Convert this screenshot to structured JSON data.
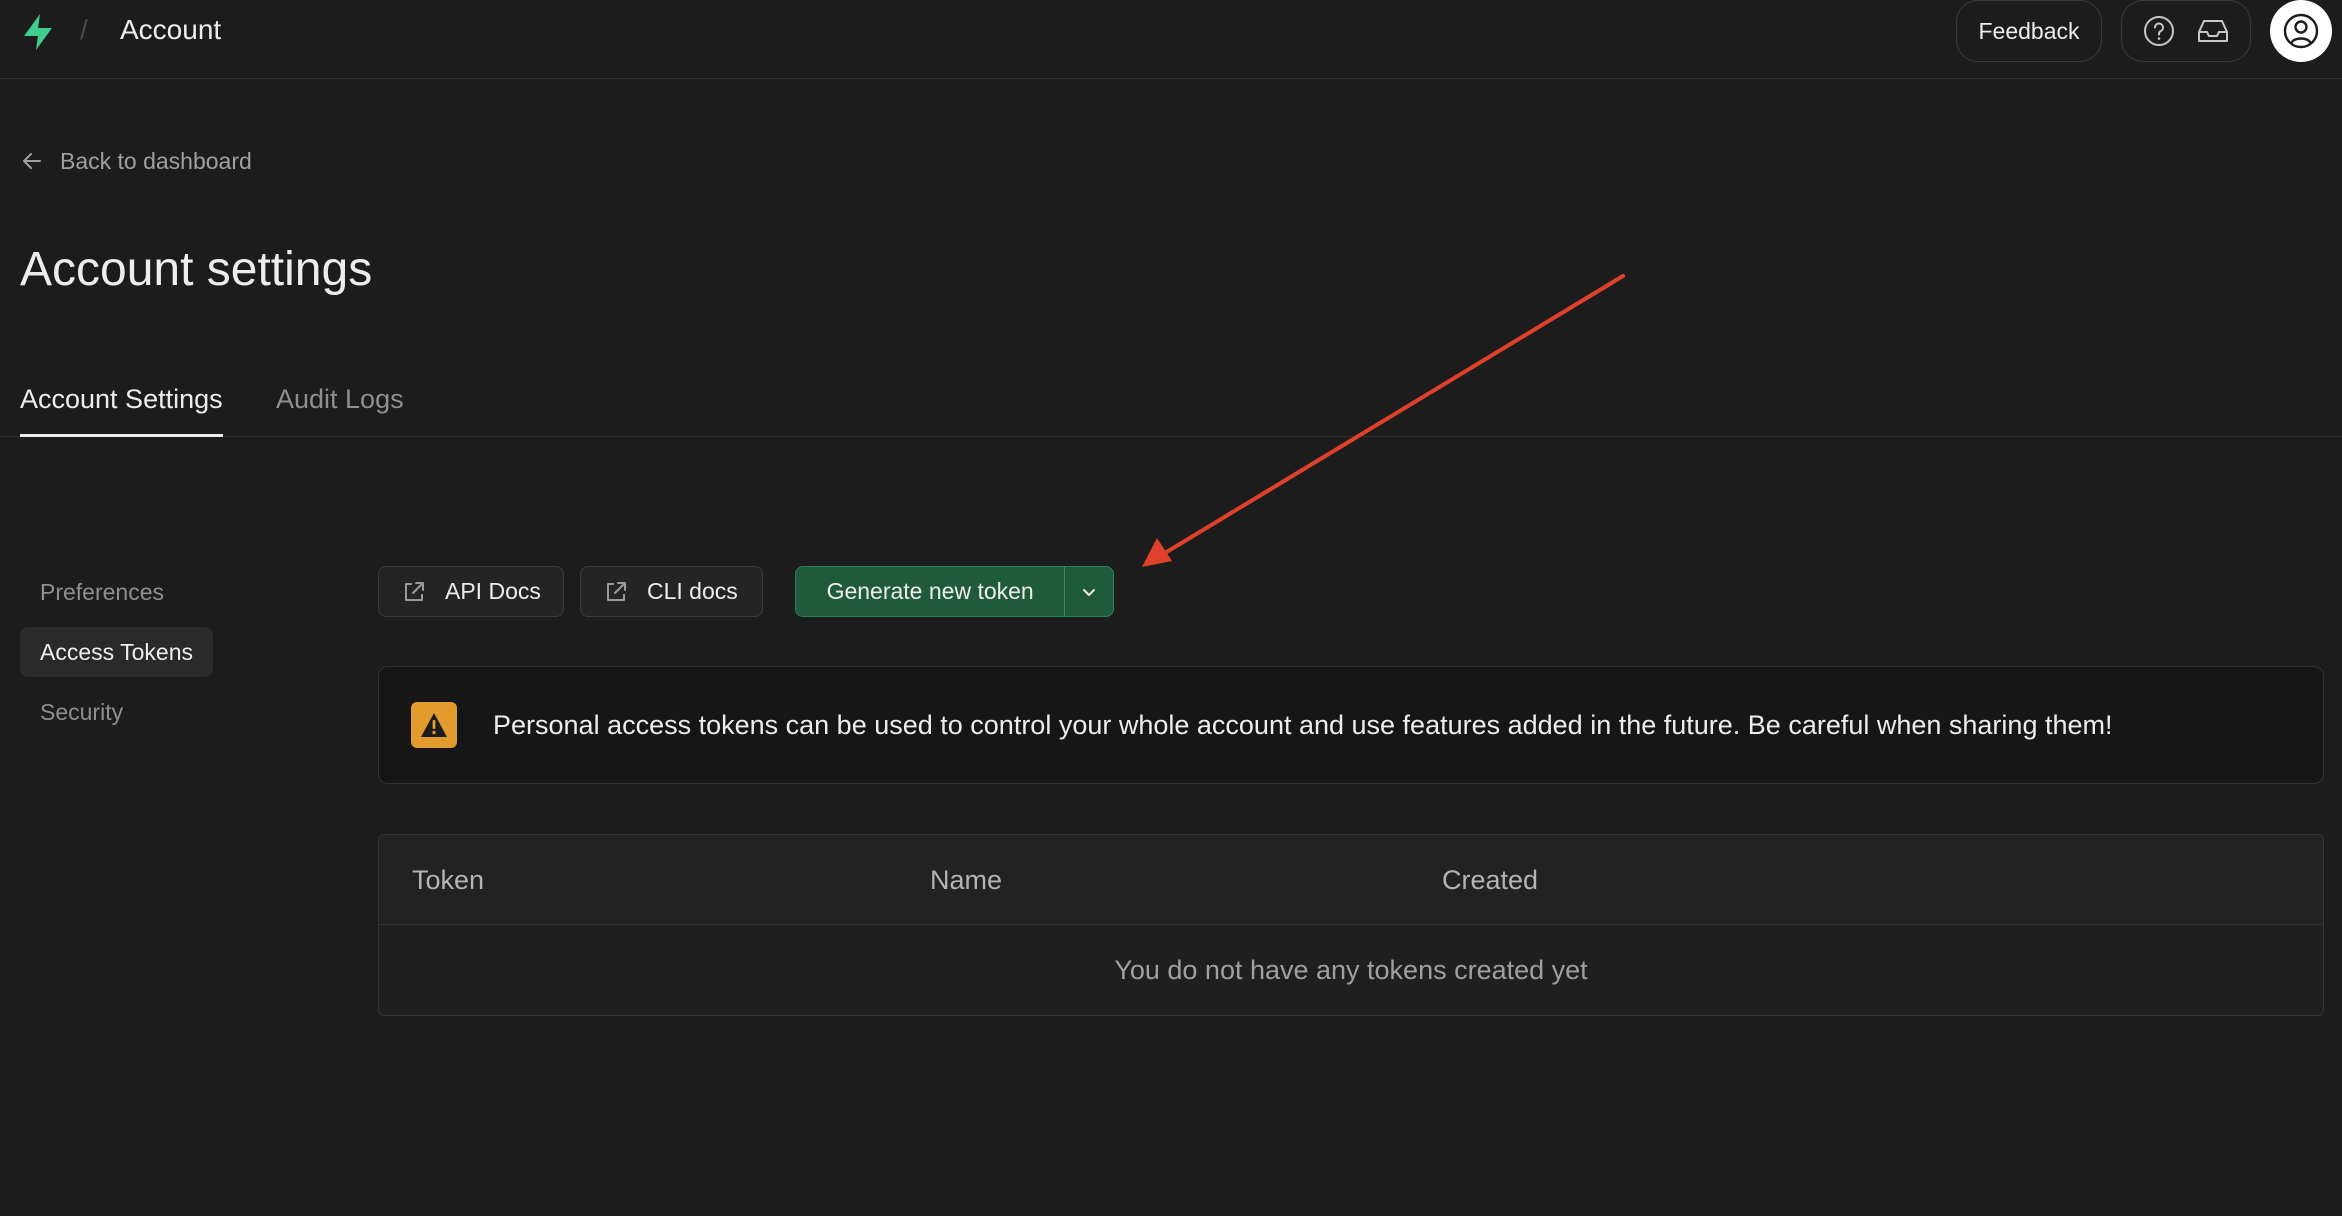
{
  "header": {
    "breadcrumb_separator": "/",
    "title": "Account",
    "feedback_label": "Feedback",
    "icons": [
      "supabase-logo-icon",
      "help-icon",
      "inbox-icon",
      "user-avatar-icon"
    ],
    "brand_color": "#3ecf8e"
  },
  "back_link": {
    "label": "Back to dashboard",
    "icon": "arrow-left-icon"
  },
  "page_title": "Account settings",
  "tabs": [
    {
      "label": "Account Settings",
      "active": true
    },
    {
      "label": "Audit Logs",
      "active": false
    }
  ],
  "sidebar": {
    "items": [
      {
        "label": "Preferences",
        "active": false
      },
      {
        "label": "Access Tokens",
        "active": true
      },
      {
        "label": "Security",
        "active": false
      }
    ]
  },
  "actions": {
    "api_docs_label": "API Docs",
    "cli_docs_label": "CLI docs",
    "generate_label": "Generate new token",
    "external_link_icon": "external-link-icon",
    "dropdown_icon": "chevron-down-icon"
  },
  "alert": {
    "icon": "warning-icon",
    "color": "#e39b2d",
    "text": "Personal access tokens can be used to control your whole account and use features added in the future. Be careful when sharing them!"
  },
  "tokens_table": {
    "columns": [
      "Token",
      "Name",
      "Created"
    ],
    "empty_message": "You do not have any tokens created yet"
  },
  "annotation": {
    "type": "arrow",
    "color": "#e0412b"
  }
}
